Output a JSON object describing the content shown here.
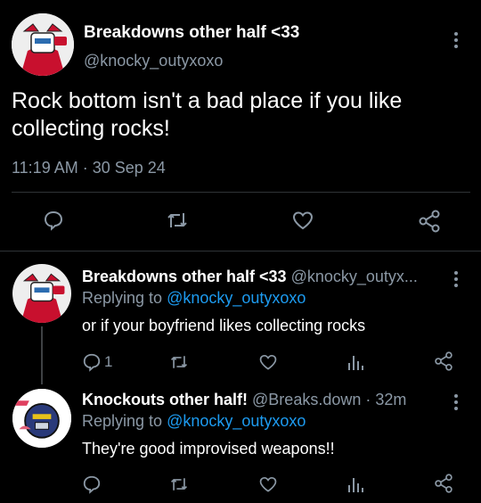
{
  "main_tweet": {
    "display_name": "Breakdowns other half <33",
    "handle": "@knocky_outyxoxo",
    "text": "Rock bottom isn't a bad place if you like collecting rocks!",
    "timestamp": "11:19 AM · 30 Sep 24",
    "actions": [
      "reply-icon",
      "retweet-icon",
      "like-icon",
      "share-icon"
    ]
  },
  "replies": [
    {
      "display_name": "Breakdowns other half <33",
      "handle_time": "@knocky_outyx...",
      "replying_prefix": "Replying to",
      "replying_to": "@knocky_outyxoxo",
      "text": "or if your boyfriend likes collecting rocks",
      "reply_count": "1"
    },
    {
      "display_name": "Knockouts other half!",
      "handle_time": "@Breaks.down · 32m",
      "replying_prefix": "Replying to",
      "replying_to": "@knocky_outyxoxo",
      "text": "They're good improvised weapons!!",
      "reply_count": ""
    }
  ],
  "colors": {
    "background": "#000000",
    "muted": "#8b98a5",
    "link": "#1d9bf0",
    "divider": "#2f3336"
  }
}
